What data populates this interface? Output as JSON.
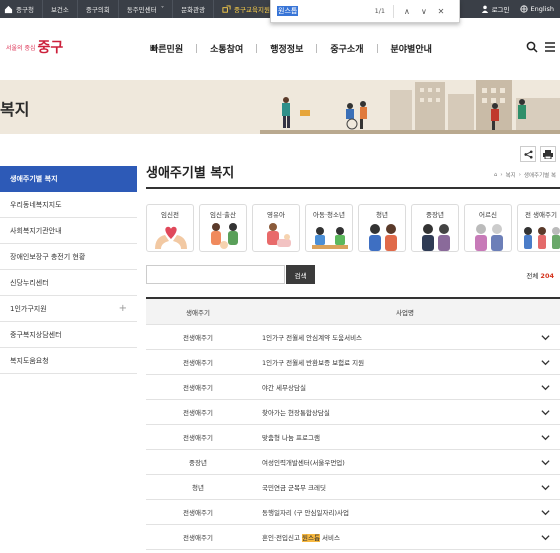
{
  "topbar": {
    "items": [
      "중구청",
      "보건소",
      "중구의회",
      "동주민센터",
      "문화관광",
      "중구교육지원센"
    ],
    "dropdown_caret": "˅",
    "login": "로그인",
    "language": "English"
  },
  "findbar": {
    "query": "원스톱",
    "count": "1/1",
    "prev": "∧",
    "next": "∨",
    "close": "✕"
  },
  "logo": {
    "small": "서울의 중심",
    "big": "중구"
  },
  "gnb": [
    "빠른민원",
    "소통참여",
    "행정정보",
    "중구소개",
    "분야별안내"
  ],
  "banner": {
    "title": "복지"
  },
  "side_menu": [
    {
      "label": "생애주기별 복지",
      "active": true
    },
    {
      "label": "우리동네복지지도"
    },
    {
      "label": "사회복지기관안내"
    },
    {
      "label": "장애인보장구 충전기 현황"
    },
    {
      "label": "신당누리센터"
    },
    {
      "label": "1인가구지원",
      "expandable": true,
      "expand_symbol": "+"
    },
    {
      "label": "중구복지상담센터"
    },
    {
      "label": "복지도움요청"
    }
  ],
  "page_title": "생애주기별 복지",
  "breadcrumb": [
    "⌂",
    "복지",
    "생애주기별 복"
  ],
  "categories": [
    "임신전",
    "임신·출산",
    "영유아",
    "아동·청소년",
    "청년",
    "중장년",
    "어르신",
    "전 생애주기"
  ],
  "search": {
    "button": "검색",
    "total_label": "전체",
    "total_count": "204"
  },
  "table": {
    "headers": [
      "생애주기",
      "사업명"
    ],
    "rows": [
      {
        "cycle": "전생애주기",
        "name": "1인가구 전월세 안심계약 도움서비스"
      },
      {
        "cycle": "전생애주기",
        "name": "1인가구 전월세 반환보증 보험료 지원"
      },
      {
        "cycle": "전생애주기",
        "name": "야간 세무상담실"
      },
      {
        "cycle": "전생애주기",
        "name": "찾아가는 현장통합상담실"
      },
      {
        "cycle": "전생애주기",
        "name": "맞춤형 나눔 프로그램"
      },
      {
        "cycle": "중장년",
        "name": "여성인력개발센터(서울우먼업)"
      },
      {
        "cycle": "청년",
        "name": "국민연금 군복무 크레딧"
      },
      {
        "cycle": "전생애주기",
        "name": "동행일자리 (구 안심일자리)사업"
      },
      {
        "cycle": "전생애주기",
        "name_before": "혼인·전입신고 ",
        "name_highlight": "원스톱",
        "name_after": " 서비스"
      }
    ]
  },
  "colors": {
    "accent": "#2d5ab7",
    "topbar": "#3a3f47",
    "highlight": "#f7b840",
    "count": "#d5351e"
  }
}
